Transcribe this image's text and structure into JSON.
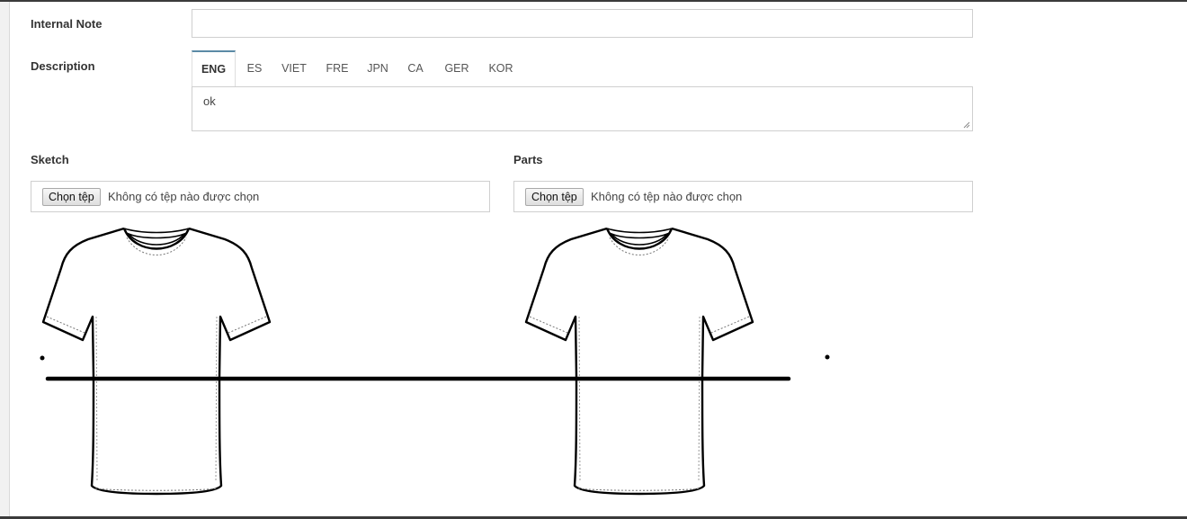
{
  "form": {
    "internal_note": {
      "label": "Internal Note",
      "value": ""
    },
    "description": {
      "label": "Description",
      "tabs": [
        "ENG",
        "ES",
        "VIET",
        "FRE",
        "JPN",
        "CA",
        "GER",
        "KOR"
      ],
      "active_tab": "ENG",
      "value": "ok"
    },
    "sketch": {
      "label": "Sketch",
      "button_label": "Chọn tệp",
      "status_text": "Không có tệp nào được chọn"
    },
    "parts": {
      "label": "Parts",
      "button_label": "Chọn tệp",
      "status_text": "Không có tệp nào được chọn"
    }
  },
  "canvas": {
    "content": [
      "tshirt-outline",
      "tshirt-outline",
      "horizontal-line",
      "dot",
      "dot"
    ],
    "stroke_color": "#000000"
  }
}
